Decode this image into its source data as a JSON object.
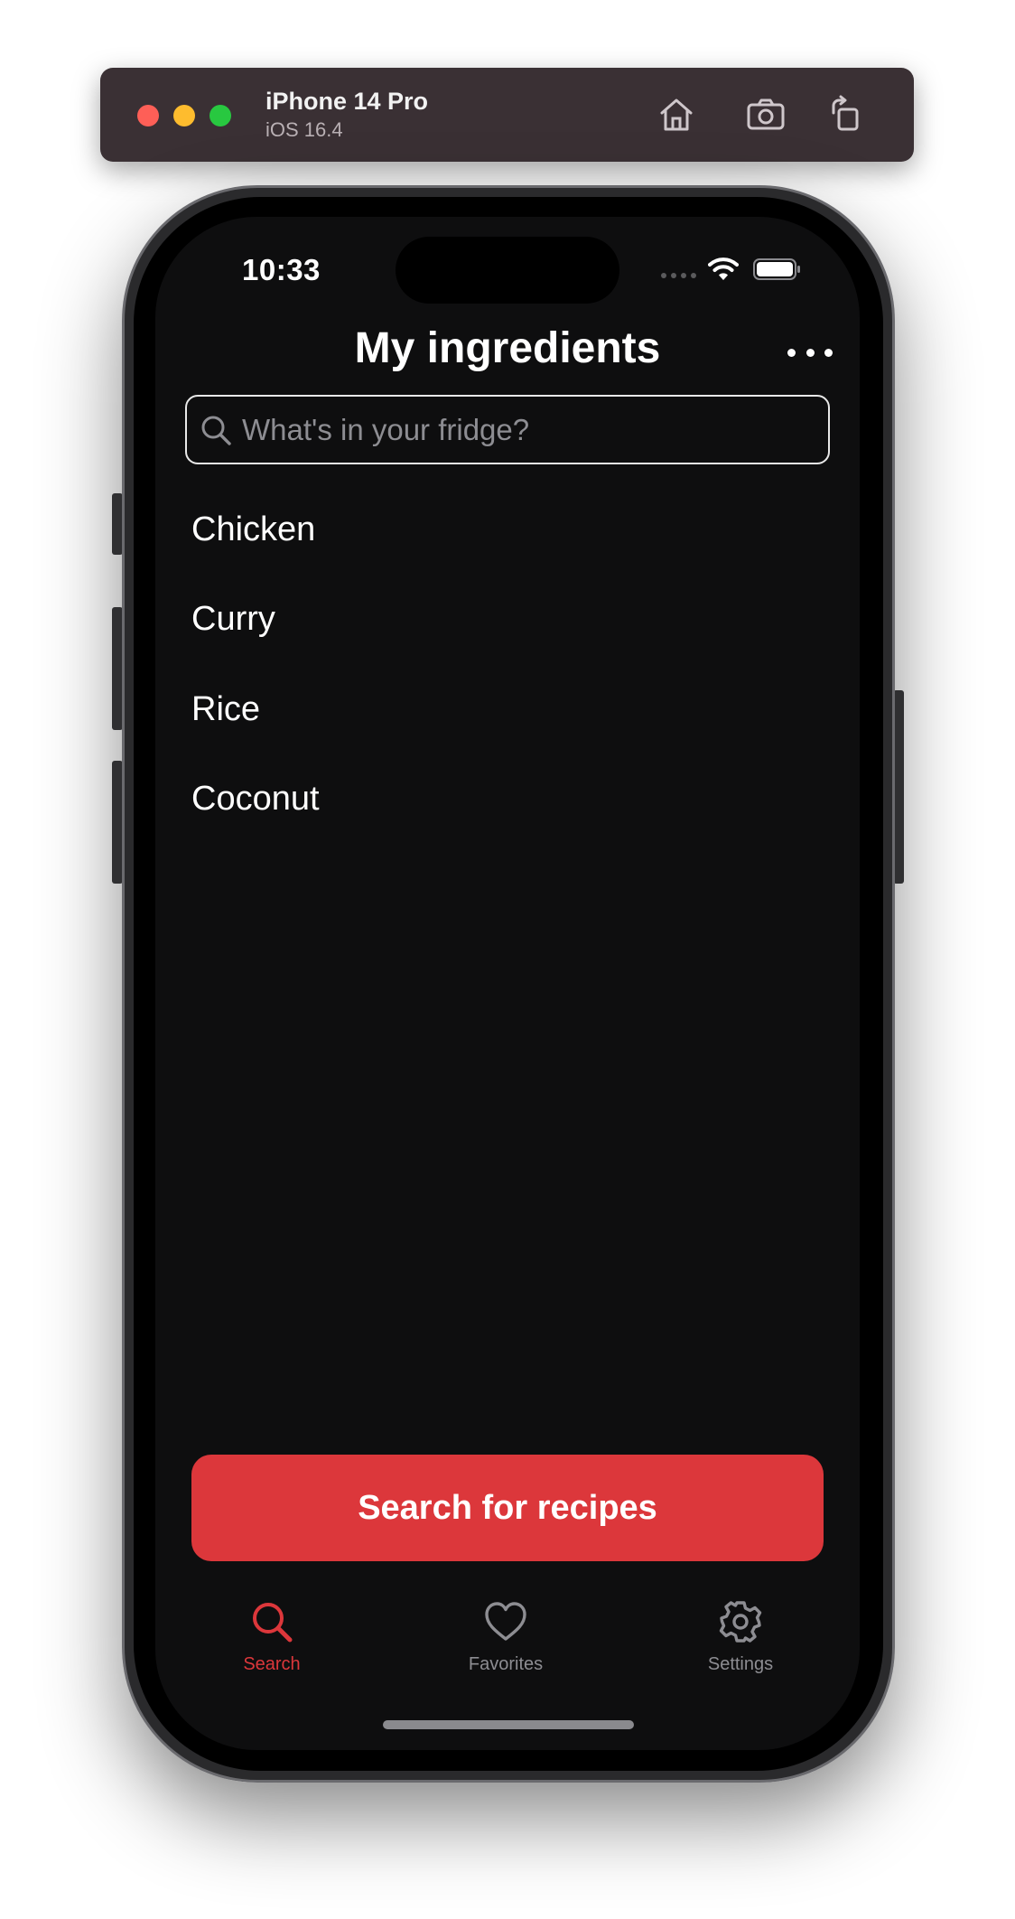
{
  "simulator": {
    "device_name": "iPhone 14 Pro",
    "os_version": "iOS 16.4",
    "buttons": [
      "home-icon",
      "screenshot-icon",
      "rotate-icon"
    ]
  },
  "status_bar": {
    "time": "10:33",
    "icons": [
      "signal-icon",
      "wifi-icon",
      "battery-icon"
    ]
  },
  "nav": {
    "title": "My ingredients",
    "more_icon": "ellipsis-icon"
  },
  "search": {
    "placeholder": "What's in your fridge?",
    "value": ""
  },
  "ingredients": [
    "Chicken",
    "Curry",
    "Rice",
    "Coconut"
  ],
  "primary_action": {
    "label": "Search for recipes"
  },
  "tabs": [
    {
      "label": "Search",
      "icon": "search-icon",
      "selected": true
    },
    {
      "label": "Favorites",
      "icon": "heart-icon",
      "selected": false
    },
    {
      "label": "Settings",
      "icon": "gear-icon",
      "selected": false
    }
  ],
  "colors": {
    "accent": "#dc373b",
    "background": "#0e0e0f",
    "inactive_tab": "#8d8d92"
  }
}
